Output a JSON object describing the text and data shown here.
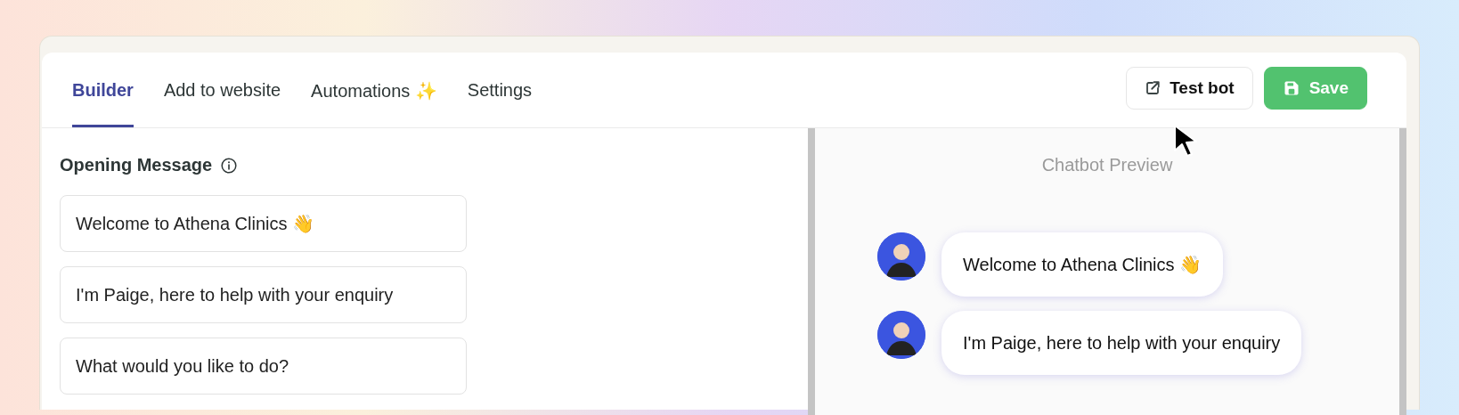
{
  "tabs": [
    {
      "label": "Builder",
      "selected": true
    },
    {
      "label": "Add to website",
      "selected": false
    },
    {
      "label": "Automations ✨",
      "selected": false
    },
    {
      "label": "Settings",
      "selected": false
    }
  ],
  "actions": [
    {
      "kind": "outline",
      "label": "Test bot"
    },
    {
      "kind": "primary",
      "label": "Save"
    }
  ],
  "opening_message": {
    "title": "Opening Message",
    "messages": [
      "Welcome to Athena Clinics 👋",
      "I'm Paige, here to help with your enquiry",
      "What would you like to do?"
    ]
  },
  "preview": {
    "title": "Chatbot Preview",
    "messages": [
      "Welcome to Athena Clinics 👋",
      "I'm Paige, here to help with your enquiry"
    ]
  }
}
